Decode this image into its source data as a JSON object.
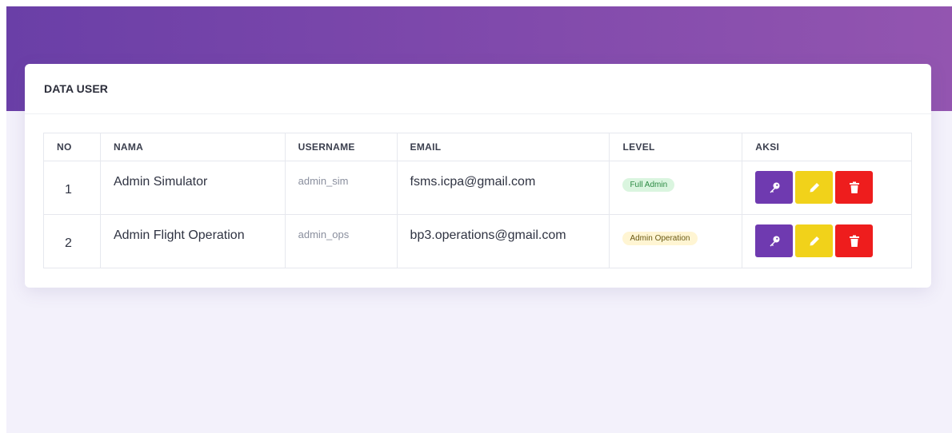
{
  "card": {
    "title": "DATA USER"
  },
  "table": {
    "headers": {
      "no": "NO",
      "nama": "NAMA",
      "username": "USERNAME",
      "email": "EMAIL",
      "level": "LEVEL",
      "aksi": "AKSI"
    },
    "rows": [
      {
        "no": "1",
        "nama": "Admin Simulator",
        "username": "admin_sim",
        "email": "fsms.icpa@gmail.com",
        "level": "Full Admin",
        "level_color": "#daf5df"
      },
      {
        "no": "2",
        "nama": "Admin Flight Operation",
        "username": "admin_ops",
        "email": "bp3.operations@gmail.com",
        "level": "Admin Operation",
        "level_color": "#fff5d3"
      }
    ]
  },
  "actions": {
    "icons": [
      "key-icon",
      "pencil-icon",
      "trash-icon"
    ],
    "colors": {
      "key": "#6f3ab0",
      "edit": "#f1d21a",
      "delete": "#ee1d1d"
    }
  },
  "theme": {
    "header_gradient_start": "#6a3fa7",
    "header_gradient_end": "#9355b0",
    "background": "#f3f1fb"
  }
}
